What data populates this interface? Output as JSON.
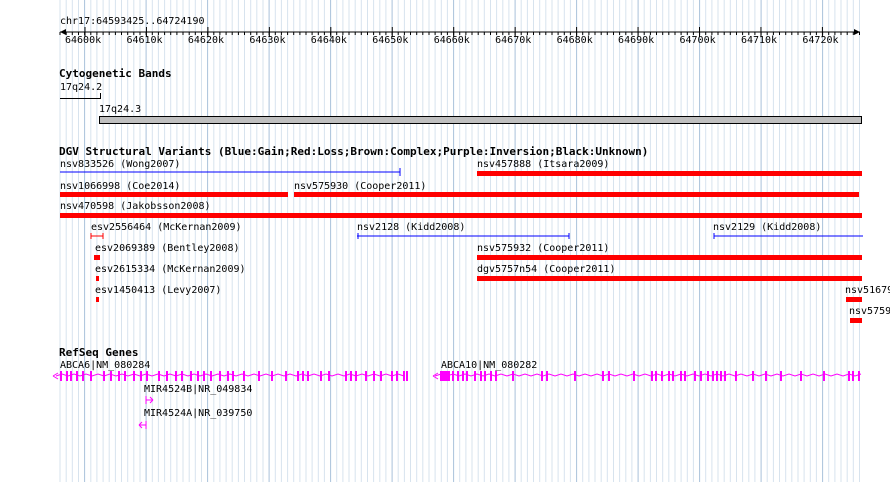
{
  "position": {
    "region": "chr17:64593425..64724190",
    "ticks": [
      "64600k",
      "64610k",
      "64620k",
      "64630k",
      "64640k",
      "64650k",
      "64660k",
      "64670k",
      "64680k",
      "64690k",
      "64700k",
      "64710k",
      "64720k"
    ]
  },
  "cytoband": {
    "title": "Cytogenetic Bands",
    "bands": [
      "17q24.2",
      "17q24.3"
    ]
  },
  "dgv": {
    "title": "DGV Structural Variants (Blue:Gain;Red:Loss;Brown:Complex;Purple:Inversion;Black:Unknown)",
    "variants": [
      {
        "label": "nsv833526 (Wong2007)",
        "color": "#0000ff"
      },
      {
        "label": "nsv457888 (Itsara2009)",
        "color": "#ff0000"
      },
      {
        "label": "nsv1066998 (Coe2014)",
        "color": "#ff0000"
      },
      {
        "label": "nsv575930 (Cooper2011)",
        "color": "#ff0000"
      },
      {
        "label": "nsv470598 (Jakobsson2008)",
        "color": "#ff0000"
      },
      {
        "label": "esv2556464 (McKernan2009)",
        "color": "#ff0000"
      },
      {
        "label": "nsv2128 (Kidd2008)",
        "color": "#0000ff"
      },
      {
        "label": "nsv2129 (Kidd2008)",
        "color": "#0000ff"
      },
      {
        "label": "esv2069389 (Bentley2008)",
        "color": "#ff0000"
      },
      {
        "label": "nsv575932 (Cooper2011)",
        "color": "#ff0000"
      },
      {
        "label": "esv2615334 (McKernan2009)",
        "color": "#ff0000"
      },
      {
        "label": "dgv5757n54 (Cooper2011)",
        "color": "#ff0000"
      },
      {
        "label": "esv1450413 (Levy2007)",
        "color": "#ff0000"
      },
      {
        "label": "nsv51679",
        "color": "#ff0000"
      },
      {
        "label": "nsv5759",
        "color": "#ff0000"
      }
    ]
  },
  "refseq": {
    "title": "RefSeq Genes",
    "genes": [
      {
        "label": "ABCA6|NM_080284",
        "strand": "minus"
      },
      {
        "label": "ABCA10|NM_080282",
        "strand": "minus"
      },
      {
        "label": "MIR4524B|NR_049834",
        "strand": "plus"
      },
      {
        "label": "MIR4524A|NR_039750",
        "strand": "minus"
      }
    ],
    "color": "#ff00ff"
  }
}
